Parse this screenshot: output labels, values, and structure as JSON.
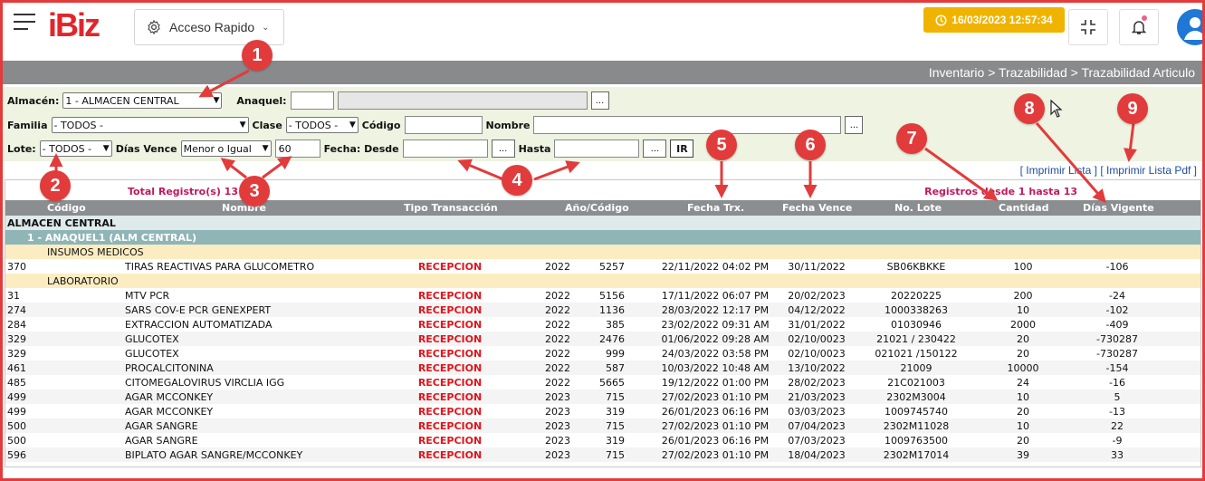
{
  "header": {
    "logo": "iBiz",
    "acceso_label": "Acceso Rapido",
    "datetime": "16/03/2023 12:57:34"
  },
  "breadcrumb": "Inventario > Trazabilidad > Trazabilidad Articulo",
  "filters": {
    "almacen_label": "Almacén:",
    "almacen_value": "1 - ALMACEN CENTRAL",
    "anaquel_label": "Anaquel:",
    "anaquel_value": "",
    "anaquel_desc": "",
    "familia_label": "Familia",
    "familia_value": "- TODOS -",
    "clase_label": "Clase",
    "clase_value": "- TODOS -",
    "codigo_label": "Código",
    "codigo_value": "",
    "nombre_label": "Nombre",
    "nombre_value": "",
    "lote_label": "Lote:",
    "lote_value": "- TODOS -",
    "dias_vence_label": "Días Vence",
    "dias_vence_op": "Menor o Igual",
    "dias_vence_value": "60",
    "fecha_desde_label": "Fecha: Desde",
    "fecha_desde_value": "",
    "hasta_label": "Hasta",
    "hasta_value": "",
    "dots": "...",
    "ir_label": "IR"
  },
  "print": {
    "lista": "[ Imprimir Lista ]",
    "pdf": "[ Imprimir Lista Pdf ]"
  },
  "table": {
    "total_text": "Total Registro(s) 13",
    "range_text": "Registros desde 1 hasta 13",
    "headers": {
      "codigo": "Código",
      "nombre": "Nombre",
      "tipo": "Tipo Transacción",
      "anio_codigo": "Año/Código",
      "fecha_trx": "Fecha Trx.",
      "fecha_vence": "Fecha Vence",
      "no_lote": "No. Lote",
      "cantidad": "Cantidad",
      "dias_vigente": "Días Vigente"
    },
    "group_almacen": "ALMACEN CENTRAL",
    "group_anaquel": "1 - ANAQUEL1 (ALM CENTRAL)",
    "families": [
      {
        "name": "INSUMOS MEDICOS",
        "rows": [
          {
            "codigo": "370",
            "nombre": "TIRAS REACTIVAS PARA GLUCOMETRO",
            "tipo": "RECEPCION",
            "anio": "2022",
            "cod": "5257",
            "fecha_trx": "22/11/2022 04:02 PM",
            "fecha_vence": "30/11/2022",
            "lote": "SB06KBKKE",
            "cantidad": "100",
            "dias": "-106"
          }
        ]
      },
      {
        "name": "LABORATORIO",
        "rows": [
          {
            "codigo": "31",
            "nombre": "MTV PCR",
            "tipo": "RECEPCION",
            "anio": "2022",
            "cod": "5156",
            "fecha_trx": "17/11/2022 06:07 PM",
            "fecha_vence": "20/02/2023",
            "lote": "20220225",
            "cantidad": "200",
            "dias": "-24"
          },
          {
            "codigo": "274",
            "nombre": "SARS COV-E PCR GENEXPERT",
            "tipo": "RECEPCION",
            "anio": "2022",
            "cod": "1136",
            "fecha_trx": "28/03/2022 12:17 PM",
            "fecha_vence": "04/12/2022",
            "lote": "1000338263",
            "cantidad": "10",
            "dias": "-102"
          },
          {
            "codigo": "284",
            "nombre": "EXTRACCION AUTOMATIZADA",
            "tipo": "RECEPCION",
            "anio": "2022",
            "cod": "385",
            "fecha_trx": "23/02/2022 09:31 AM",
            "fecha_vence": "31/01/2022",
            "lote": "01030946",
            "cantidad": "2000",
            "dias": "-409"
          },
          {
            "codigo": "329",
            "nombre": "GLUCOTEX",
            "tipo": "RECEPCION",
            "anio": "2022",
            "cod": "2476",
            "fecha_trx": "01/06/2022 09:28 AM",
            "fecha_vence": "02/10/0023",
            "lote": "21021 / 230422",
            "cantidad": "20",
            "dias": "-730287"
          },
          {
            "codigo": "329",
            "nombre": "GLUCOTEX",
            "tipo": "RECEPCION",
            "anio": "2022",
            "cod": "999",
            "fecha_trx": "24/03/2022 03:58 PM",
            "fecha_vence": "02/10/0023",
            "lote": "021021 /150122",
            "cantidad": "20",
            "dias": "-730287"
          },
          {
            "codigo": "461",
            "nombre": "PROCALCITONINA",
            "tipo": "RECEPCION",
            "anio": "2022",
            "cod": "587",
            "fecha_trx": "10/03/2022 10:48 AM",
            "fecha_vence": "13/10/2022",
            "lote": "21009",
            "cantidad": "10000",
            "dias": "-154"
          },
          {
            "codigo": "485",
            "nombre": "CITOMEGALOVIRUS VIRCLIA IGG",
            "tipo": "RECEPCION",
            "anio": "2022",
            "cod": "5665",
            "fecha_trx": "19/12/2022 01:00 PM",
            "fecha_vence": "28/02/2023",
            "lote": "21C021003",
            "cantidad": "24",
            "dias": "-16"
          },
          {
            "codigo": "499",
            "nombre": "AGAR MCCONKEY",
            "tipo": "RECEPCION",
            "anio": "2023",
            "cod": "715",
            "fecha_trx": "27/02/2023 01:10 PM",
            "fecha_vence": "21/03/2023",
            "lote": "2302M3004",
            "cantidad": "10",
            "dias": "5"
          },
          {
            "codigo": "499",
            "nombre": "AGAR MCCONKEY",
            "tipo": "RECEPCION",
            "anio": "2023",
            "cod": "319",
            "fecha_trx": "26/01/2023 06:16 PM",
            "fecha_vence": "03/03/2023",
            "lote": "1009745740",
            "cantidad": "20",
            "dias": "-13"
          },
          {
            "codigo": "500",
            "nombre": "AGAR SANGRE",
            "tipo": "RECEPCION",
            "anio": "2023",
            "cod": "715",
            "fecha_trx": "27/02/2023 01:10 PM",
            "fecha_vence": "07/04/2023",
            "lote": "2302M11028",
            "cantidad": "10",
            "dias": "22"
          },
          {
            "codigo": "500",
            "nombre": "AGAR SANGRE",
            "tipo": "RECEPCION",
            "anio": "2023",
            "cod": "319",
            "fecha_trx": "26/01/2023 06:16 PM",
            "fecha_vence": "07/03/2023",
            "lote": "1009763500",
            "cantidad": "20",
            "dias": "-9"
          },
          {
            "codigo": "596",
            "nombre": "BIPLATO AGAR SANGRE/MCCONKEY",
            "tipo": "RECEPCION",
            "anio": "2023",
            "cod": "715",
            "fecha_trx": "27/02/2023 01:10 PM",
            "fecha_vence": "18/04/2023",
            "lote": "2302M17014",
            "cantidad": "39",
            "dias": "33"
          }
        ]
      }
    ]
  },
  "annotations": [
    "1",
    "2",
    "3",
    "4",
    "5",
    "6",
    "7",
    "8",
    "9"
  ],
  "colors": {
    "brand": "#e1262b",
    "date_badge": "#f0b400",
    "header_bar": "#888a8c",
    "filter_bg": "#eef3e2",
    "transaction": "#e0141b",
    "callout": "#e23b3b"
  }
}
